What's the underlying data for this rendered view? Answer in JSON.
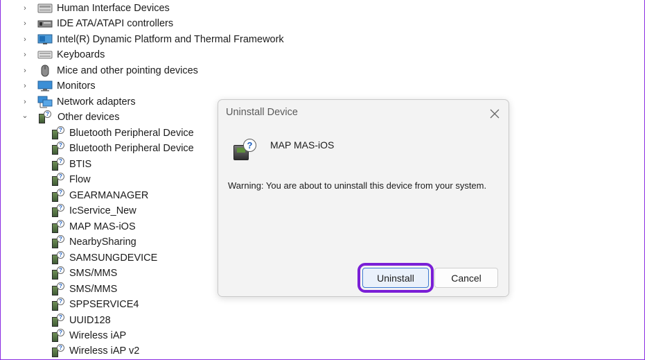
{
  "tree": {
    "categories": [
      {
        "label": "Human Interface Devices",
        "icon": "hid-icon",
        "expanded": false
      },
      {
        "label": "IDE ATA/ATAPI controllers",
        "icon": "ide-controller-icon",
        "expanded": false
      },
      {
        "label": "Intel(R) Dynamic Platform and Thermal Framework",
        "icon": "monitor-board-icon",
        "expanded": false
      },
      {
        "label": "Keyboards",
        "icon": "keyboard-icon",
        "expanded": false
      },
      {
        "label": "Mice and other pointing devices",
        "icon": "mouse-icon",
        "expanded": false
      },
      {
        "label": "Monitors",
        "icon": "monitor-icon",
        "expanded": false
      },
      {
        "label": "Network adapters",
        "icon": "network-icon",
        "expanded": false
      },
      {
        "label": "Other devices",
        "icon": "unknown-device-icon",
        "expanded": true
      }
    ],
    "other_devices": [
      "Bluetooth Peripheral Device",
      "Bluetooth Peripheral Device",
      "BTIS",
      "Flow",
      "GEARMANAGER",
      "IcService_New",
      "MAP MAS-iOS",
      "NearbySharing",
      "SAMSUNGDEVICE",
      "SMS/MMS",
      "SMS/MMS",
      "SPPSERVICE4",
      "UUID128",
      "Wireless iAP",
      "Wireless iAP v2"
    ]
  },
  "dialog": {
    "title": "Uninstall Device",
    "close_glyph": "✕",
    "device_name": "MAP MAS-iOS",
    "warning": "Warning: You are about to uninstall this device from your system.",
    "uninstall_label": "Uninstall",
    "cancel_label": "Cancel",
    "highlight_color": "#7a1fd6"
  },
  "glyphs": {
    "chevron_right": "›",
    "chevron_down": "⌄",
    "question": "?"
  }
}
